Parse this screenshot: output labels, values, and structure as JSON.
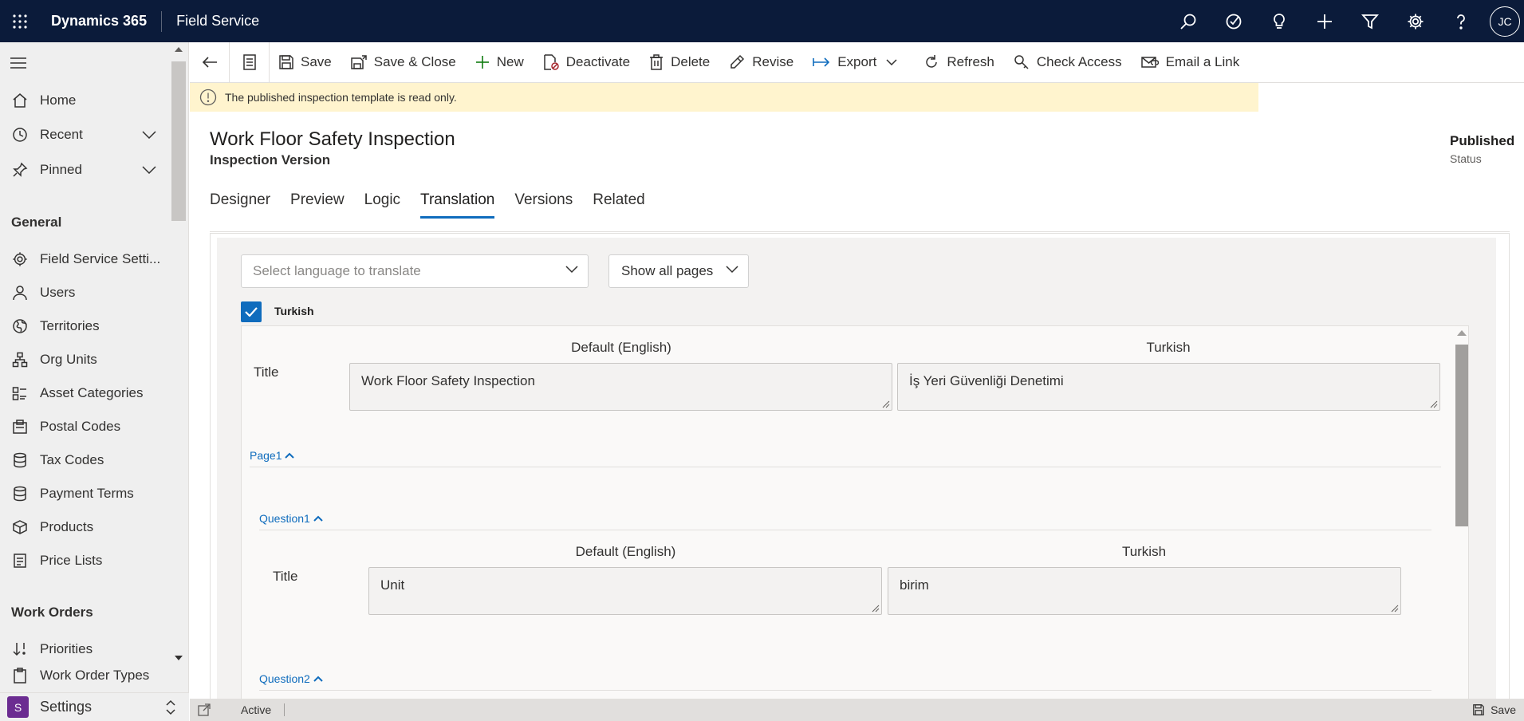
{
  "topbar": {
    "app_name": "Dynamics 365",
    "area_name": "Field Service",
    "user_initials": "JC",
    "icons": [
      "search-icon",
      "task-check-icon",
      "lightbulb-icon",
      "plus-icon",
      "filter-icon",
      "gear-icon",
      "help-icon"
    ]
  },
  "sidebar": {
    "top_items": [
      {
        "label": "Home",
        "icon": "home-icon"
      },
      {
        "label": "Recent",
        "icon": "clock-icon"
      },
      {
        "label": "Pinned",
        "icon": "pin-icon"
      }
    ],
    "group_general": "General",
    "general_items": [
      {
        "label": "Field Service Setti...",
        "icon": "gear-icon"
      },
      {
        "label": "Users",
        "icon": "person-icon"
      },
      {
        "label": "Territories",
        "icon": "globe-icon"
      },
      {
        "label": "Org Units",
        "icon": "org-icon"
      },
      {
        "label": "Asset Categories",
        "icon": "asset-icon"
      },
      {
        "label": "Postal Codes",
        "icon": "postal-icon"
      },
      {
        "label": "Tax Codes",
        "icon": "database-icon"
      },
      {
        "label": "Payment Terms",
        "icon": "database-icon"
      },
      {
        "label": "Products",
        "icon": "box-icon"
      },
      {
        "label": "Price Lists",
        "icon": "document-icon"
      }
    ],
    "group_work_orders": "Work Orders",
    "work_order_items": [
      {
        "label": "Priorities",
        "icon": "priority-icon"
      },
      {
        "label": "Work Order Types",
        "icon": "clipboard-icon"
      }
    ],
    "area_switcher": {
      "badge": "S",
      "label": "Settings"
    }
  },
  "commandbar": {
    "save": "Save",
    "save_close": "Save & Close",
    "new": "New",
    "deactivate": "Deactivate",
    "delete": "Delete",
    "revise": "Revise",
    "export": "Export",
    "refresh": "Refresh",
    "check_access": "Check Access",
    "email_link": "Email a Link"
  },
  "notification": "The published inspection template is read only.",
  "record": {
    "title": "Work Floor Safety Inspection",
    "entity": "Inspection Version",
    "status_value": "Published",
    "status_label": "Status"
  },
  "tabs": [
    "Designer",
    "Preview",
    "Logic",
    "Translation",
    "Versions",
    "Related"
  ],
  "active_tab": "Translation",
  "translation": {
    "language_placeholder": "Select language to translate",
    "pages_filter": "Show all pages",
    "language_checked": "Turkish",
    "default_col": "Default (English)",
    "target_col": "Turkish",
    "title_label": "Title",
    "template_title_default": "Work Floor Safety Inspection",
    "template_title_translated": "İş Yeri Güvenliği Denetimi",
    "page1": "Page1",
    "question1": "Question1",
    "question1_default": "Unit",
    "question1_translated": "birim",
    "question2": "Question2"
  },
  "statusbar": {
    "state": "Active",
    "save": "Save"
  },
  "colors": {
    "topbar_bg": "#0b1b3a",
    "accent": "#0f6cbd",
    "notification_bg": "#fff4ce",
    "settings_badge": "#6b2c91"
  }
}
